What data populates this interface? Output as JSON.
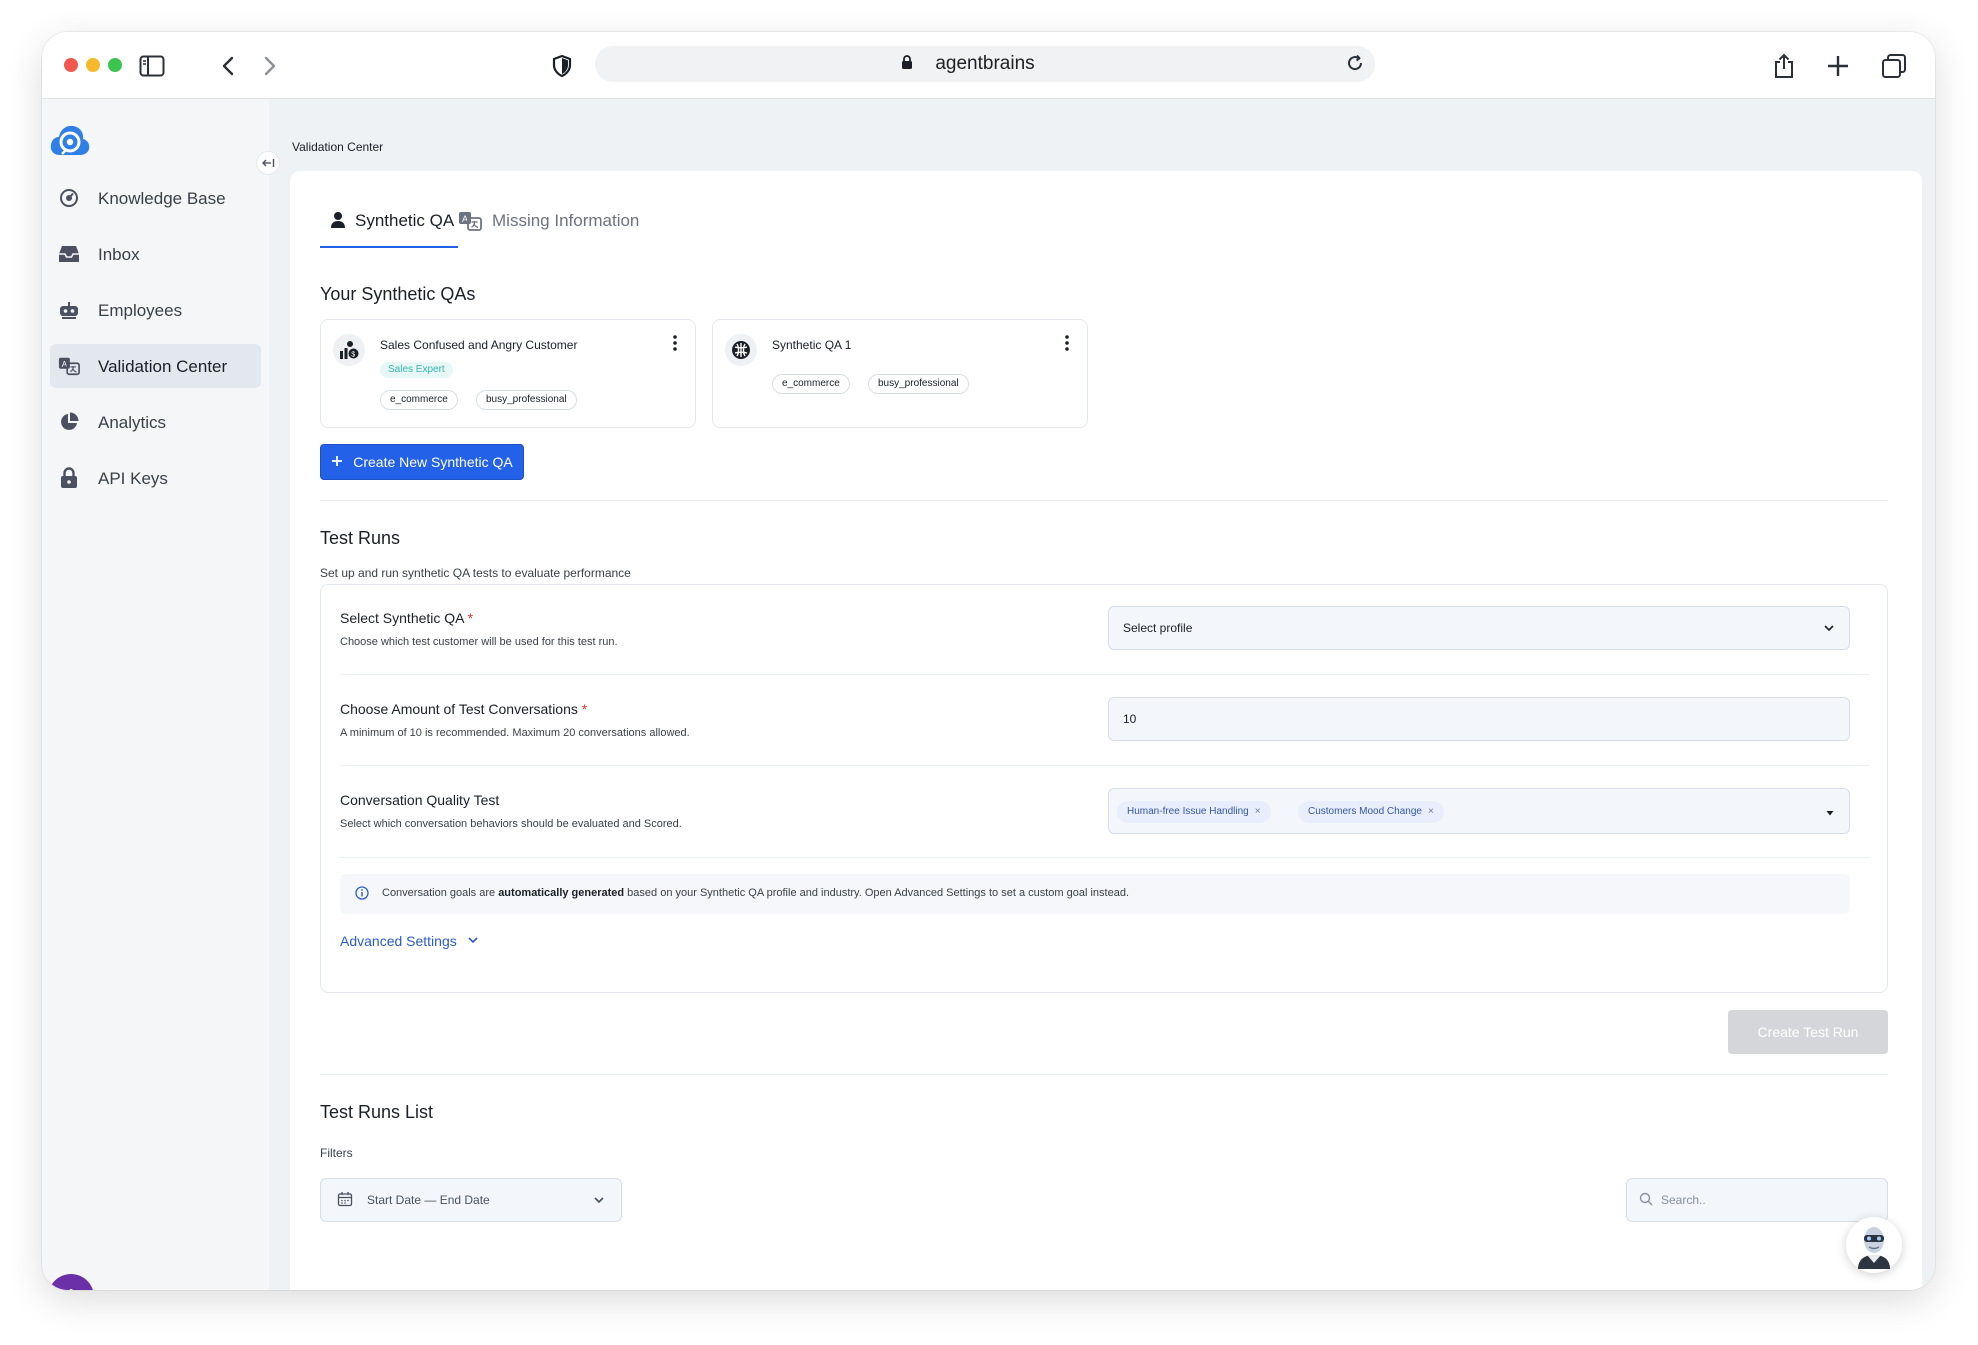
{
  "browser": {
    "url": "agentbrains"
  },
  "sidebar": {
    "items": [
      {
        "label": "Knowledge Base",
        "icon": "gauge-icon"
      },
      {
        "label": "Inbox",
        "icon": "inbox-icon"
      },
      {
        "label": "Employees",
        "icon": "robot-icon"
      },
      {
        "label": "Validation Center",
        "icon": "translate-icon",
        "active": true
      },
      {
        "label": "Analytics",
        "icon": "pie-chart-icon"
      },
      {
        "label": "API Keys",
        "icon": "lock-icon"
      }
    ],
    "avatar_initial": "A"
  },
  "breadcrumb": "Validation Center",
  "tabs": [
    {
      "label": "Synthetic QA",
      "active": true
    },
    {
      "label": "Missing Information",
      "active": false
    }
  ],
  "synthetic_qas": {
    "heading": "Your Synthetic QAs",
    "cards": [
      {
        "title": "Sales Confused and Angry Customer",
        "role": "Sales Expert",
        "tags": [
          "e_commerce",
          "busy_professional"
        ]
      },
      {
        "title": "Synthetic QA 1",
        "tags": [
          "e_commerce",
          "busy_professional"
        ]
      }
    ],
    "create_button": "Create New Synthetic QA"
  },
  "test_runs": {
    "heading": "Test Runs",
    "subtitle": "Set up and run synthetic QA tests to evaluate performance",
    "fields": {
      "select_qa": {
        "label": "Select Synthetic QA",
        "required_mark": "*",
        "hint": "Choose which test customer will be used for this test run.",
        "placeholder": "Select profile"
      },
      "amount": {
        "label": "Choose Amount of Test Conversations",
        "required_mark": "*",
        "hint": "A minimum of 10 is recommended. Maximum 20 conversations allowed.",
        "value": "10"
      },
      "quality": {
        "label": "Conversation Quality Test",
        "hint": "Select which conversation behaviors should be evaluated and Scored.",
        "tags": [
          "Human-free Issue Handling",
          "Customers Mood Change"
        ],
        "remove_glyph": "×"
      }
    },
    "info": {
      "before": "Conversation goals are ",
      "bold": "automatically generated",
      "after": " based on your Synthetic QA profile and industry. Open Advanced Settings to set a custom goal instead."
    },
    "advanced_settings": "Advanced Settings",
    "create_button": "Create Test Run"
  },
  "test_runs_list": {
    "heading": "Test Runs List",
    "filters_label": "Filters",
    "date_range": "Start Date — End Date",
    "search_placeholder": "Search.."
  },
  "colors": {
    "primary": "#2361e8",
    "required": "#e0322c",
    "role_badge": "#36b7ae",
    "avatar": "#6b2fa8"
  }
}
